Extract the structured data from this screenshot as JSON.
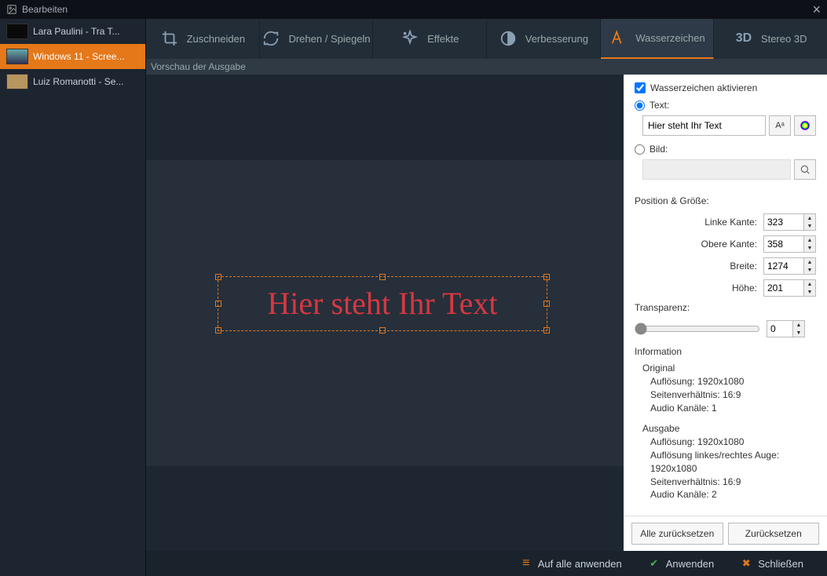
{
  "window": {
    "title": "Bearbeiten"
  },
  "sidebar": {
    "items": [
      {
        "label": "Lara Paulini  - Tra T..."
      },
      {
        "label": "Windows 11 - Scree..."
      },
      {
        "label": "Luiz Romanotti - Se..."
      }
    ]
  },
  "tools": {
    "crop": "Zuschneiden",
    "rotate": "Drehen / Spiegeln",
    "effects": "Effekte",
    "enhance": "Verbesserung",
    "watermark": "Wasserzeichen",
    "stereo": "Stereo 3D"
  },
  "preview": {
    "subheader": "Vorschau der Ausgabe",
    "watermark_text": "Hier steht Ihr Text"
  },
  "panel": {
    "activate": "Wasserzeichen aktivieren",
    "text_label": "Text:",
    "text_value": "Hier steht Ihr Text",
    "font_btn": "Aᵃ",
    "image_label": "Bild:",
    "pos_section": "Position & Größe:",
    "left_label": "Linke Kante:",
    "left_val": "323",
    "top_label": "Obere Kante:",
    "top_val": "358",
    "width_label": "Breite:",
    "width_val": "1274",
    "height_label": "Höhe:",
    "height_val": "201",
    "transparency_label": "Transparenz:",
    "transparency_val": "0",
    "info_title": "Information",
    "original_title": "Original",
    "output_title": "Ausgabe",
    "res_label": "Auflösung: 1920x1080",
    "aspect_label": "Seitenverhältnis: 16:9",
    "audio1": "Audio Kanäle: 1",
    "audio2": "Audio Kanäle: 2",
    "res_eye": "Auflösung linkes/rechtes Auge: 1920x1080",
    "reset_all": "Alle zurücksetzen",
    "reset": "Zurücksetzen"
  },
  "footer": {
    "apply_all": "Auf alle anwenden",
    "apply": "Anwenden",
    "close": "Schließen"
  }
}
